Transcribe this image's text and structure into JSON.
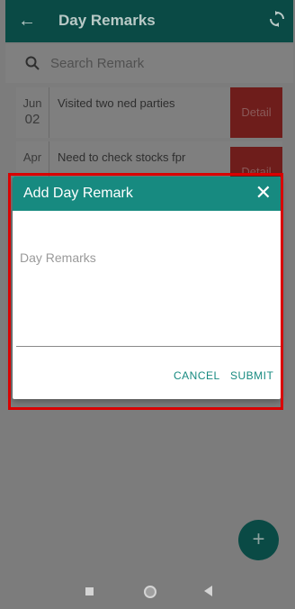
{
  "appbar": {
    "title": "Day Remarks",
    "back_icon": "arrow-left-icon",
    "refresh_icon": "refresh-icon"
  },
  "search": {
    "placeholder": "Search Remark",
    "icon": "search-icon"
  },
  "remarks": [
    {
      "month": "Jun",
      "day": "02",
      "text": "Visited two ned parties",
      "action": "Detail"
    },
    {
      "month": "Apr",
      "day": "",
      "text": "Need to check stocks fpr",
      "action": "Detail"
    }
  ],
  "dialog": {
    "title": "Add Day Remark",
    "placeholder": "Day Remarks",
    "cancel_label": "CANCEL",
    "submit_label": "SUBMIT",
    "close_icon": "close-icon"
  },
  "fab": {
    "label": "+",
    "icon": "add-icon"
  },
  "colors": {
    "primary_dark": "#0a4a45",
    "accent": "#178a80",
    "detail_red": "#d13a37",
    "highlight_red": "#d90000"
  }
}
